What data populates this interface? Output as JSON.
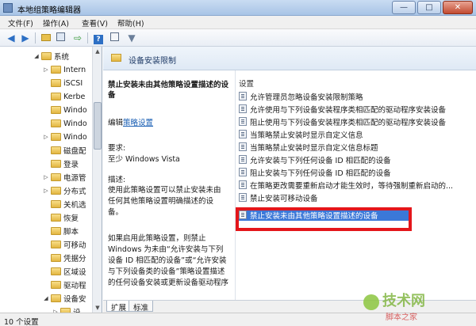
{
  "window": {
    "title": "本地组策略编辑器",
    "buttons": [
      "—",
      "□",
      "✕"
    ]
  },
  "menu": [
    "文件(F)",
    "操作(A)",
    "查看(V)",
    "帮助(H)"
  ],
  "toolbar": {
    "icons": [
      "back-arrow-icon",
      "forward-arrow-icon",
      "folder-up-icon",
      "show-hide-tree-icon",
      "export-icon",
      "help-icon",
      "properties-icon",
      "filter-icon"
    ]
  },
  "tree": {
    "items": [
      {
        "label": "系统",
        "expanded": true
      },
      {
        "label": "Intern"
      },
      {
        "label": "iSCSI"
      },
      {
        "label": "Kerbe"
      },
      {
        "label": "Windo"
      },
      {
        "label": "Windo"
      },
      {
        "label": "Windo"
      },
      {
        "label": "磁盘配"
      },
      {
        "label": "登录"
      },
      {
        "label": "电源管"
      },
      {
        "label": "分布式"
      },
      {
        "label": "关机选"
      },
      {
        "label": "恢复"
      },
      {
        "label": "脚本"
      },
      {
        "label": "可移动"
      },
      {
        "label": "凭据分"
      },
      {
        "label": "区域设"
      },
      {
        "label": "驱动程"
      },
      {
        "label": "设备安",
        "expanded": true
      },
      {
        "label": "设"
      }
    ]
  },
  "header": {
    "title": "设备安装限制"
  },
  "description": {
    "title": "禁止安装未由其他策略设置描述的设备",
    "edit_prefix": "编辑",
    "edit_link": "策略设置",
    "requirements_label": "要求:",
    "requirements_value": "至少 Windows Vista",
    "description_heading": "描述:",
    "text1": "使用此策略设置可以禁止安装未由任何其他策略设置明确描述的设备。",
    "text2": "如果启用此策略设置，则禁止 Windows 为未由“允许安装与下列设备 ID 相匹配的设备”或“允许安装与下列设备类的设备”策略设置描述的任何设备安装或更新设备驱动程序"
  },
  "list": {
    "header": "设置",
    "items": [
      "允许管理员忽略设备安装限制策略",
      "允许使用与下列设备安装程序类相匹配的驱动程序安装设备",
      "阻止使用与下列设备安装程序类相匹配的驱动程序安装设备",
      "当策略禁止安装时显示自定义信息",
      "当策略禁止安装时显示自定义信息标题",
      "允许安装与下列任何设备 ID 相匹配的设备",
      "阻止安装与下列任何设备 ID 相匹配的设备",
      "在策略更改需要重新启动才能生效时，等待强制重新启动的...",
      "禁止安装可移动设备",
      "禁止安装未由其他策略设置描述的设备"
    ],
    "selected_index": 9
  },
  "tabs": [
    "扩展",
    "标准"
  ],
  "status": {
    "text": "10 个设置"
  },
  "watermark": {
    "text": "技术网",
    "sub": "脚本之家"
  },
  "colors": {
    "selection": "#3b78d8",
    "highlight_border": "#e4161b",
    "link": "#1a5fb4"
  }
}
